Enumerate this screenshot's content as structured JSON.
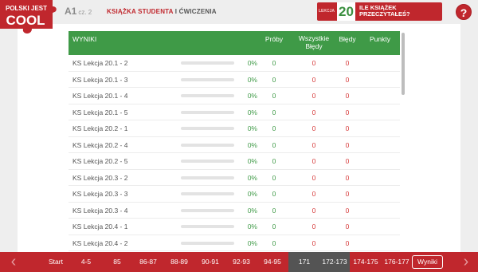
{
  "logo": {
    "line1": "POLSKI JEST",
    "line2": "COOL"
  },
  "header": {
    "level": "A1",
    "part": "cz. 2",
    "title_red": "KSIĄŻKA STUDENTA",
    "title_sep": " I ",
    "title_rest": "ĆWICZENIA",
    "lesson_label": "LEKCJA",
    "lesson_number": "20",
    "lesson_question": "ILE KSIĄŻEK PRZECZYTAŁEŚ?",
    "help": "?"
  },
  "table": {
    "headers": {
      "wyniki": "WYNIKI",
      "proby": "Próby",
      "wszystkie": "Wszystkie Błędy",
      "bledy": "Błędy",
      "punkty": "Punkty"
    },
    "rows": [
      {
        "name": "KS Lekcja 20.1 - 2",
        "progress": 0,
        "percent": "0%",
        "proby": "0",
        "wszystkie": "0",
        "bledy": "0",
        "punkty": ""
      },
      {
        "name": "KS Lekcja 20.1 - 3",
        "progress": 0,
        "percent": "0%",
        "proby": "0",
        "wszystkie": "0",
        "bledy": "0",
        "punkty": ""
      },
      {
        "name": "KS Lekcja 20.1 - 4",
        "progress": 0,
        "percent": "0%",
        "proby": "0",
        "wszystkie": "0",
        "bledy": "0",
        "punkty": ""
      },
      {
        "name": "KS Lekcja 20.1 - 5",
        "progress": 0,
        "percent": "0%",
        "proby": "0",
        "wszystkie": "0",
        "bledy": "0",
        "punkty": ""
      },
      {
        "name": "KS Lekcja 20.2 - 1",
        "progress": 0,
        "percent": "0%",
        "proby": "0",
        "wszystkie": "0",
        "bledy": "0",
        "punkty": ""
      },
      {
        "name": "KS Lekcja 20.2 - 4",
        "progress": 0,
        "percent": "0%",
        "proby": "0",
        "wszystkie": "0",
        "bledy": "0",
        "punkty": ""
      },
      {
        "name": "KS Lekcja 20.2 - 5",
        "progress": 0,
        "percent": "0%",
        "proby": "0",
        "wszystkie": "0",
        "bledy": "0",
        "punkty": ""
      },
      {
        "name": "KS Lekcja 20.3 - 2",
        "progress": 0,
        "percent": "0%",
        "proby": "0",
        "wszystkie": "0",
        "bledy": "0",
        "punkty": ""
      },
      {
        "name": "KS Lekcja 20.3 - 3",
        "progress": 0,
        "percent": "0%",
        "proby": "0",
        "wszystkie": "0",
        "bledy": "0",
        "punkty": ""
      },
      {
        "name": "KS Lekcja 20.3 - 4",
        "progress": 0,
        "percent": "0%",
        "proby": "0",
        "wszystkie": "0",
        "bledy": "0",
        "punkty": ""
      },
      {
        "name": "KS Lekcja 20.4 - 1",
        "progress": 0,
        "percent": "0%",
        "proby": "0",
        "wszystkie": "0",
        "bledy": "0",
        "punkty": ""
      },
      {
        "name": "KS Lekcja 20.4 - 2",
        "progress": 0,
        "percent": "0%",
        "proby": "0",
        "wszystkie": "0",
        "bledy": "0",
        "punkty": ""
      }
    ]
  },
  "nav": {
    "prev_icon": "chevron-left-icon",
    "next_icon": "chevron-right-icon",
    "prev": "‹",
    "next": "›",
    "items": [
      {
        "label": "Start",
        "active": false,
        "results": false
      },
      {
        "label": "4-5",
        "active": false,
        "results": false
      },
      {
        "label": "85",
        "active": false,
        "results": false
      },
      {
        "label": "86-87",
        "active": false,
        "results": false
      },
      {
        "label": "88-89",
        "active": false,
        "results": false
      },
      {
        "label": "90-91",
        "active": false,
        "results": false
      },
      {
        "label": "92-93",
        "active": false,
        "results": false
      },
      {
        "label": "94-95",
        "active": false,
        "results": false
      },
      {
        "label": "171",
        "active": true,
        "results": false
      },
      {
        "label": "172-173",
        "active": true,
        "results": false
      },
      {
        "label": "174-175",
        "active": false,
        "results": false
      },
      {
        "label": "176-177",
        "active": false,
        "results": false
      },
      {
        "label": "Wyniki",
        "active": false,
        "results": true
      }
    ]
  },
  "colors": {
    "brand_red": "#c0272d",
    "header_green": "#3f9a47",
    "nav_active": "#545454",
    "error_red": "#d63a3a"
  }
}
